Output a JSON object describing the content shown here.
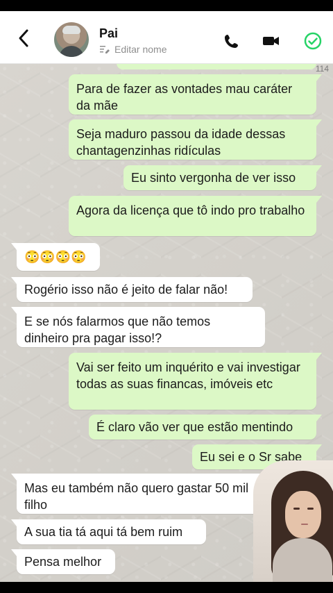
{
  "header": {
    "contact_name": "Pai",
    "edit_label": "Editar nome"
  },
  "chat": {
    "count_label": "114",
    "messages": [
      {
        "text": "Para de fazer as vontades mau caráter da mãe"
      },
      {
        "text": "Seja maduro passou da idade dessas chantagenzinhas ridículas"
      },
      {
        "text": "Eu sinto vergonha de ver isso"
      },
      {
        "text": "Agora da licença que tô indo pro trabalho"
      },
      {
        "text": "😳😳😳😳"
      },
      {
        "text": "Rogério isso não é jeito de falar não!"
      },
      {
        "text": "E se nós falarmos que não temos dinheiro pra pagar isso!?"
      },
      {
        "text": "Vai ser feito um inquérito e vai investigar todas as suas financas, imóveis etc"
      },
      {
        "text": "É claro vão ver que estão mentindo"
      },
      {
        "text": "Eu sei e o Sr sabe"
      },
      {
        "text": "Mas eu também não quero gastar 50 mil filho"
      },
      {
        "text": "A sua tia tá aqui tá bem ruim"
      },
      {
        "text": "Pensa melhor"
      }
    ]
  },
  "icons": {
    "back": "chevron-left-icon",
    "call": "phone-icon",
    "video": "video-camera-icon",
    "check": "check-circle-icon",
    "edit": "edit-name-icon"
  },
  "colors": {
    "outgoing_bubble": "#dcf8c6",
    "incoming_bubble": "#ffffff",
    "accent": "#25d366"
  }
}
